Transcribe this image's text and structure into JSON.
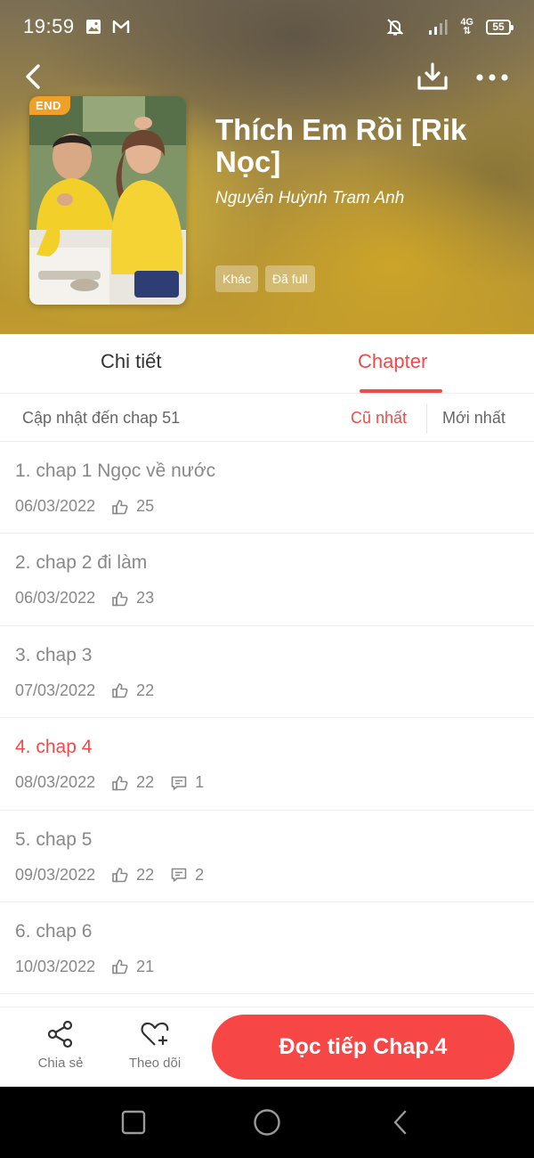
{
  "status_bar": {
    "time": "19:59",
    "network_label": "4G",
    "battery_level": "55",
    "icons": [
      "image-icon",
      "gmail-icon",
      "mute-bell-icon",
      "signal-icon",
      "battery-icon"
    ]
  },
  "header": {
    "cover_badge": "END",
    "title": "Thích Em Rồi [Rik Nọc]",
    "author": "Nguyễn Huỳnh Tram Anh",
    "tags": [
      "Khác",
      "Đã full"
    ]
  },
  "tabs": {
    "details": "Chi tiết",
    "chapter": "Chapter",
    "active": "chapter"
  },
  "sort_bar": {
    "update_info": "Cập nhật đến chap 51",
    "oldest": "Cũ nhất",
    "newest": "Mới nhất",
    "active": "oldest"
  },
  "chapters": [
    {
      "title": "1. chap 1 Ngọc về nước",
      "date": "06/03/2022",
      "likes": "25",
      "comments": null,
      "active": false
    },
    {
      "title": "2. chap 2 đi làm",
      "date": "06/03/2022",
      "likes": "23",
      "comments": null,
      "active": false
    },
    {
      "title": "3. chap 3",
      "date": "07/03/2022",
      "likes": "22",
      "comments": null,
      "active": false
    },
    {
      "title": "4. chap 4",
      "date": "08/03/2022",
      "likes": "22",
      "comments": "1",
      "active": true
    },
    {
      "title": "5. chap 5",
      "date": "09/03/2022",
      "likes": "22",
      "comments": "2",
      "active": false
    },
    {
      "title": "6. chap 6",
      "date": "10/03/2022",
      "likes": "21",
      "comments": null,
      "active": false
    }
  ],
  "bottom_bar": {
    "share": "Chia sẻ",
    "follow": "Theo dõi",
    "read_continue": "Đọc tiếp Chap.4"
  },
  "colors": {
    "accent": "#f24a48",
    "read_button": "#f74646",
    "badge": "#f0a028"
  }
}
